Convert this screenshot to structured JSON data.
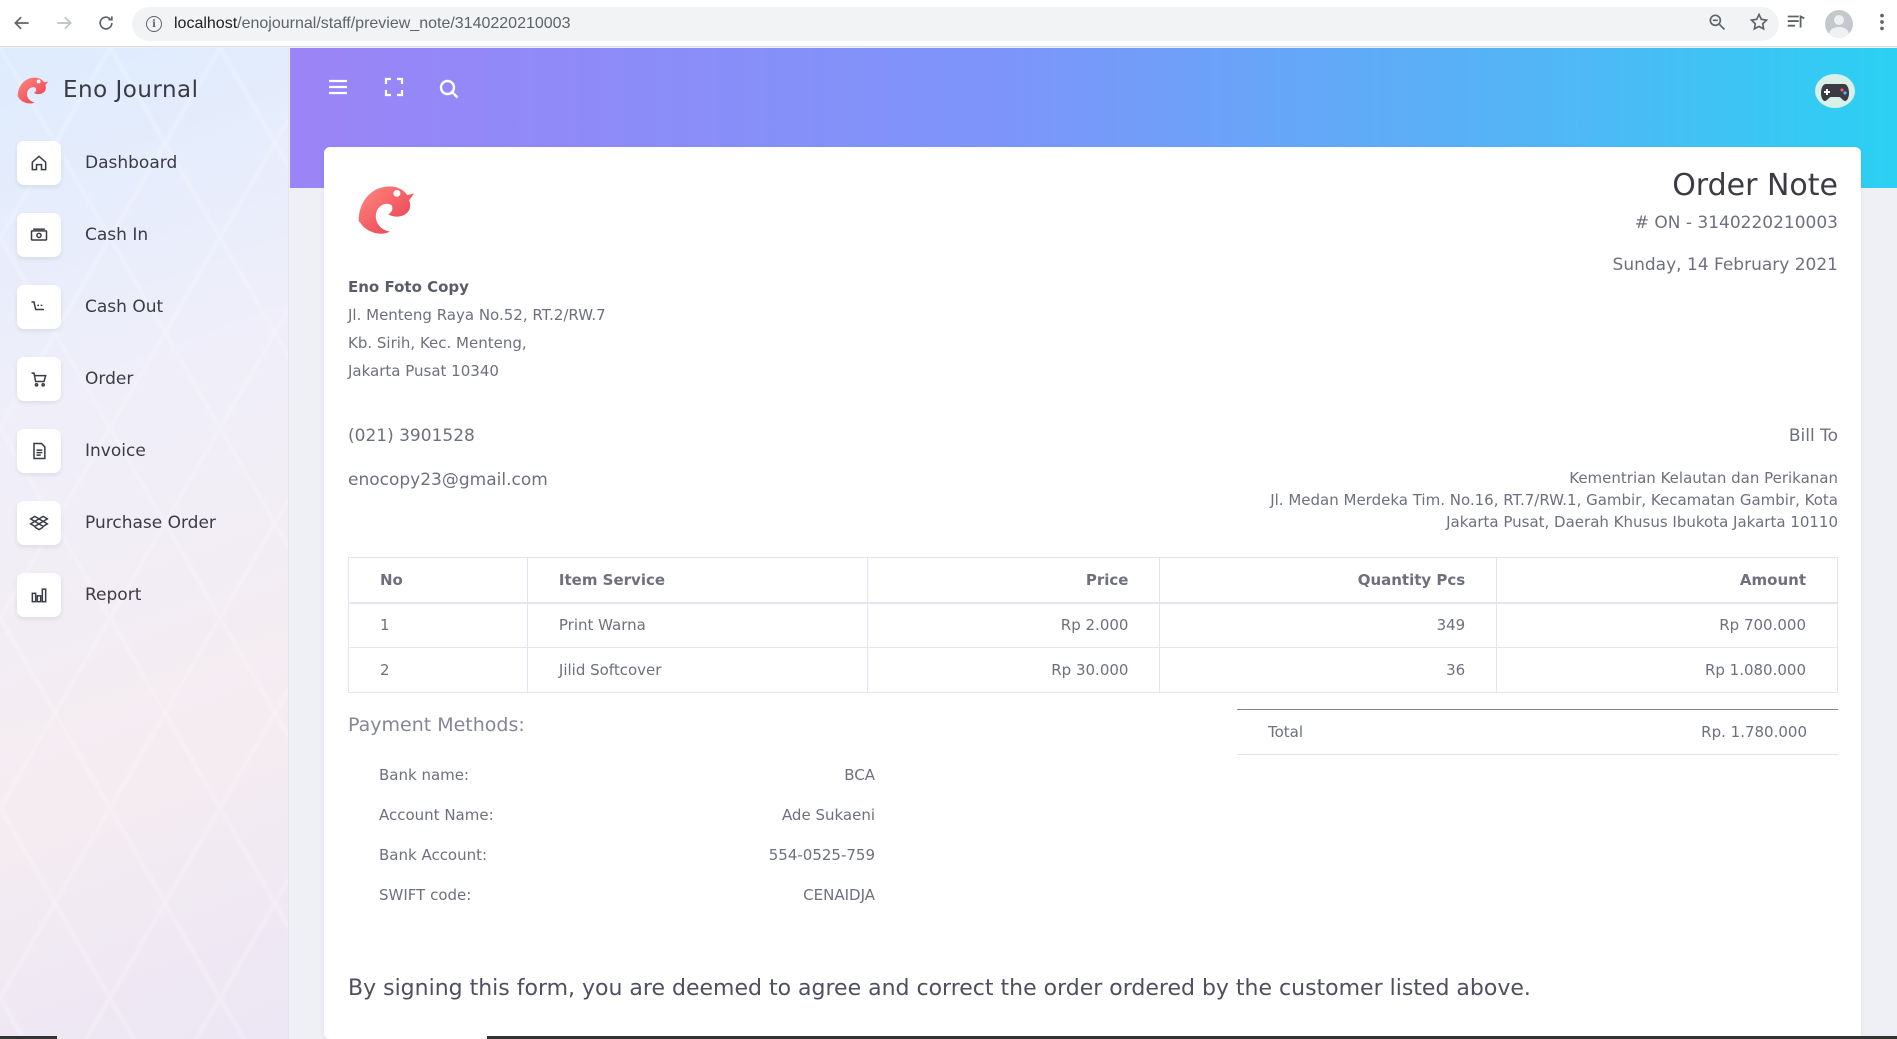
{
  "browser": {
    "url_host": "localhost",
    "url_path": "/enojournal/staff/preview_note/3140220210003"
  },
  "app": {
    "name": "Eno Journal"
  },
  "sidebar": {
    "items": [
      {
        "label": "Dashboard",
        "icon": "home-icon"
      },
      {
        "label": "Cash In",
        "icon": "money-icon"
      },
      {
        "label": "Cash Out",
        "icon": "cart-out-icon"
      },
      {
        "label": "Order",
        "icon": "cart-icon"
      },
      {
        "label": "Invoice",
        "icon": "document-icon"
      },
      {
        "label": "Purchase Order",
        "icon": "dropbox-icon"
      },
      {
        "label": "Report",
        "icon": "bar-chart-icon"
      }
    ]
  },
  "note": {
    "title": "Order Note",
    "number": "# ON - 3140220210003",
    "date": "Sunday, 14 February 2021",
    "company": {
      "name": "Eno Foto Copy",
      "address": [
        "Jl. Menteng Raya No.52, RT.2/RW.7",
        "Kb. Sirih, Kec. Menteng,",
        "Jakarta Pusat 10340"
      ],
      "phone": "(021) 3901528",
      "email": "enocopy23@gmail.com"
    },
    "bill_to": {
      "label": "Bill To",
      "lines": [
        "Kementrian Kelautan dan Perikanan",
        "Jl. Medan Merdeka Tim. No.16, RT.7/RW.1, Gambir, Kecamatan Gambir, Kota",
        "Jakarta Pusat, Daerah Khusus Ibukota Jakarta 10110"
      ]
    },
    "table": {
      "headers": [
        "No",
        "Item Service",
        "Price",
        "Quantity Pcs",
        "Amount"
      ],
      "rows": [
        [
          "1",
          "Print Warna",
          "Rp 2.000",
          "349",
          "Rp 700.000"
        ],
        [
          "2",
          "Jilid Softcover",
          "Rp 30.000",
          "36",
          "Rp 1.080.000"
        ]
      ]
    },
    "total": {
      "label": "Total",
      "value": "Rp. 1.780.000"
    },
    "payment": {
      "title": "Payment Methods:",
      "rows": [
        {
          "label": "Bank name:",
          "value": "BCA"
        },
        {
          "label": "Account Name:",
          "value": "Ade Sukaeni"
        },
        {
          "label": "Bank Account:",
          "value": "554-0525-759"
        },
        {
          "label": "SWIFT code:",
          "value": "CENAIDJA"
        }
      ]
    },
    "agreement": "By signing this form, you are deemed to agree and correct the order ordered by the customer listed above."
  },
  "colors": {
    "logo": "#f0595e",
    "gradient_start": "#9b84f7",
    "gradient_end": "#2bd0f2"
  }
}
